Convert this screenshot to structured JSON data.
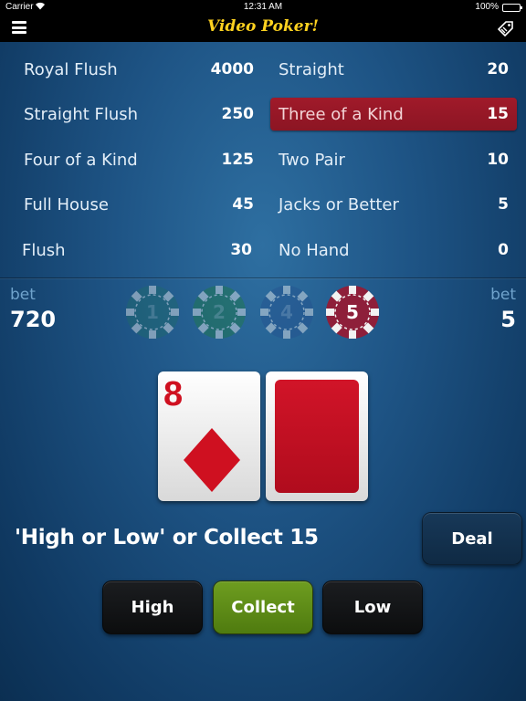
{
  "status_bar": {
    "carrier": "Carrier",
    "time": "12:31 AM",
    "battery": "100%"
  },
  "nav": {
    "title": "Video Poker!",
    "menu_icon": "hamburger-icon",
    "right_icon": "price-tag-icon"
  },
  "paytable": {
    "left": [
      {
        "name": "Royal Flush",
        "value": "4000"
      },
      {
        "name": "Straight Flush",
        "value": "250"
      },
      {
        "name": "Four of a Kind",
        "value": "125"
      },
      {
        "name": "Full House",
        "value": "45"
      },
      {
        "name": "Flush",
        "value": "30"
      }
    ],
    "right": [
      {
        "name": "Straight",
        "value": "20"
      },
      {
        "name": "Three of a Kind",
        "value": "15"
      },
      {
        "name": "Two Pair",
        "value": "10"
      },
      {
        "name": "Jacks or Better",
        "value": "5"
      },
      {
        "name": "No Hand",
        "value": "0"
      }
    ],
    "highlighted": "Three of a Kind",
    "highlight_color": "#9c1727"
  },
  "bet": {
    "left_label": "bet",
    "left_value": "720",
    "right_label": "bet",
    "right_value": "5"
  },
  "chips": [
    {
      "label": "1",
      "color": "#1f6b6a",
      "selected": false
    },
    {
      "label": "2",
      "color": "#1f7a45",
      "selected": false
    },
    {
      "label": "4",
      "color": "#25528f",
      "selected": false
    },
    {
      "label": "5",
      "color": "#8e1f3a",
      "selected": true
    }
  ],
  "cards": [
    {
      "rank": "8",
      "suit": "diamond",
      "face_up": true,
      "color": "#cf1020"
    },
    {
      "face_up": false,
      "back_color": "#c4101f"
    }
  ],
  "message": "'High or Low' or Collect 15",
  "buttons": {
    "deal": "Deal",
    "high": "High",
    "collect": "Collect",
    "low": "Low"
  }
}
